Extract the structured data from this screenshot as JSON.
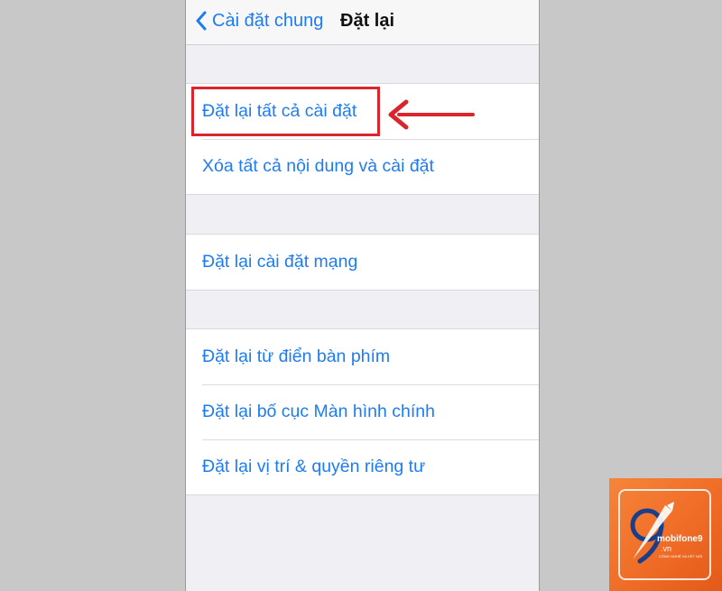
{
  "navbar": {
    "back_label": "Cài đặt chung",
    "title": "Đặt lại"
  },
  "groups": [
    {
      "items": [
        {
          "label": "Đặt lại tất cả cài đặt"
        },
        {
          "label": "Xóa tất cả nội dung và cài đặt"
        }
      ]
    },
    {
      "items": [
        {
          "label": "Đặt lại cài đặt mạng"
        }
      ]
    },
    {
      "items": [
        {
          "label": "Đặt lại từ điển bàn phím"
        },
        {
          "label": "Đặt lại bố cục Màn hình chính"
        },
        {
          "label": "Đặt lại vị trí & quyền riêng tư"
        }
      ]
    }
  ],
  "watermark": {
    "brand": "mobifone9",
    "domain": ".vn",
    "tagline": "CÔNG NGHỆ VÀ KẾT NỐI"
  },
  "colors": {
    "link_blue": "#1e7cf2",
    "highlight_red": "#d9262c",
    "logo_orange": "#ee6a25"
  },
  "icons": {
    "back": "chevron-left-icon",
    "annotation": "arrow-left-icon"
  }
}
